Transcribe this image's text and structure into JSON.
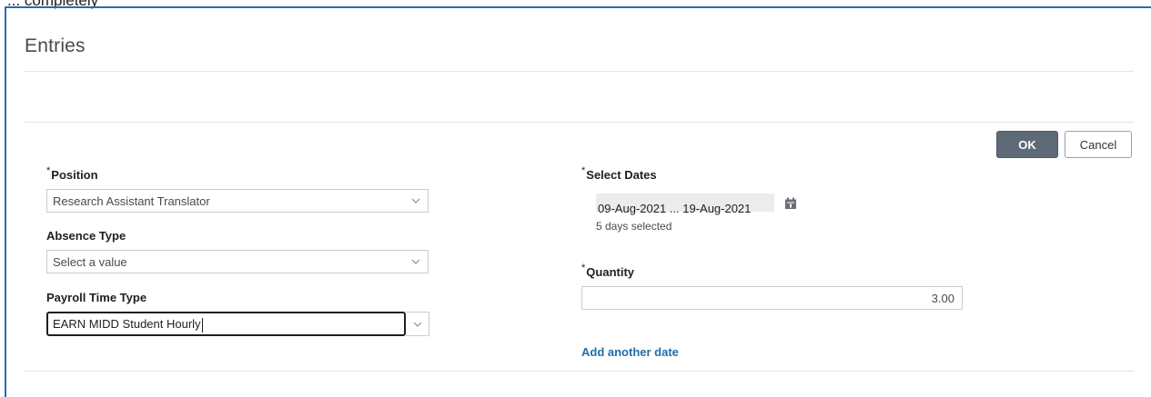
{
  "header_text": "... completely",
  "page": {
    "title": "Entries"
  },
  "actions": {
    "ok_label": "OK",
    "cancel_label": "Cancel"
  },
  "form": {
    "position": {
      "label": "Position",
      "required_mark": "*",
      "value": "Research Assistant Translator"
    },
    "absence_type": {
      "label": "Absence Type",
      "value": "Select a value"
    },
    "payroll_time_type": {
      "label": "Payroll Time Type",
      "value": "EARN MIDD Student Hourly"
    },
    "select_dates": {
      "label": "Select Dates",
      "required_mark": "*",
      "range": "09-Aug-2021 ... 19-Aug-2021",
      "summary": "5 days selected"
    },
    "quantity": {
      "label": "Quantity",
      "required_mark": "*",
      "value": "3.00"
    },
    "add_date_link": "Add another date"
  },
  "icons": {
    "dropdown": "chevron-down-icon",
    "calendar": "calendar-icon"
  },
  "colors": {
    "frame_border": "#2a6ab4",
    "ok_button": "#5f6a79",
    "link": "#1f6ea8"
  }
}
